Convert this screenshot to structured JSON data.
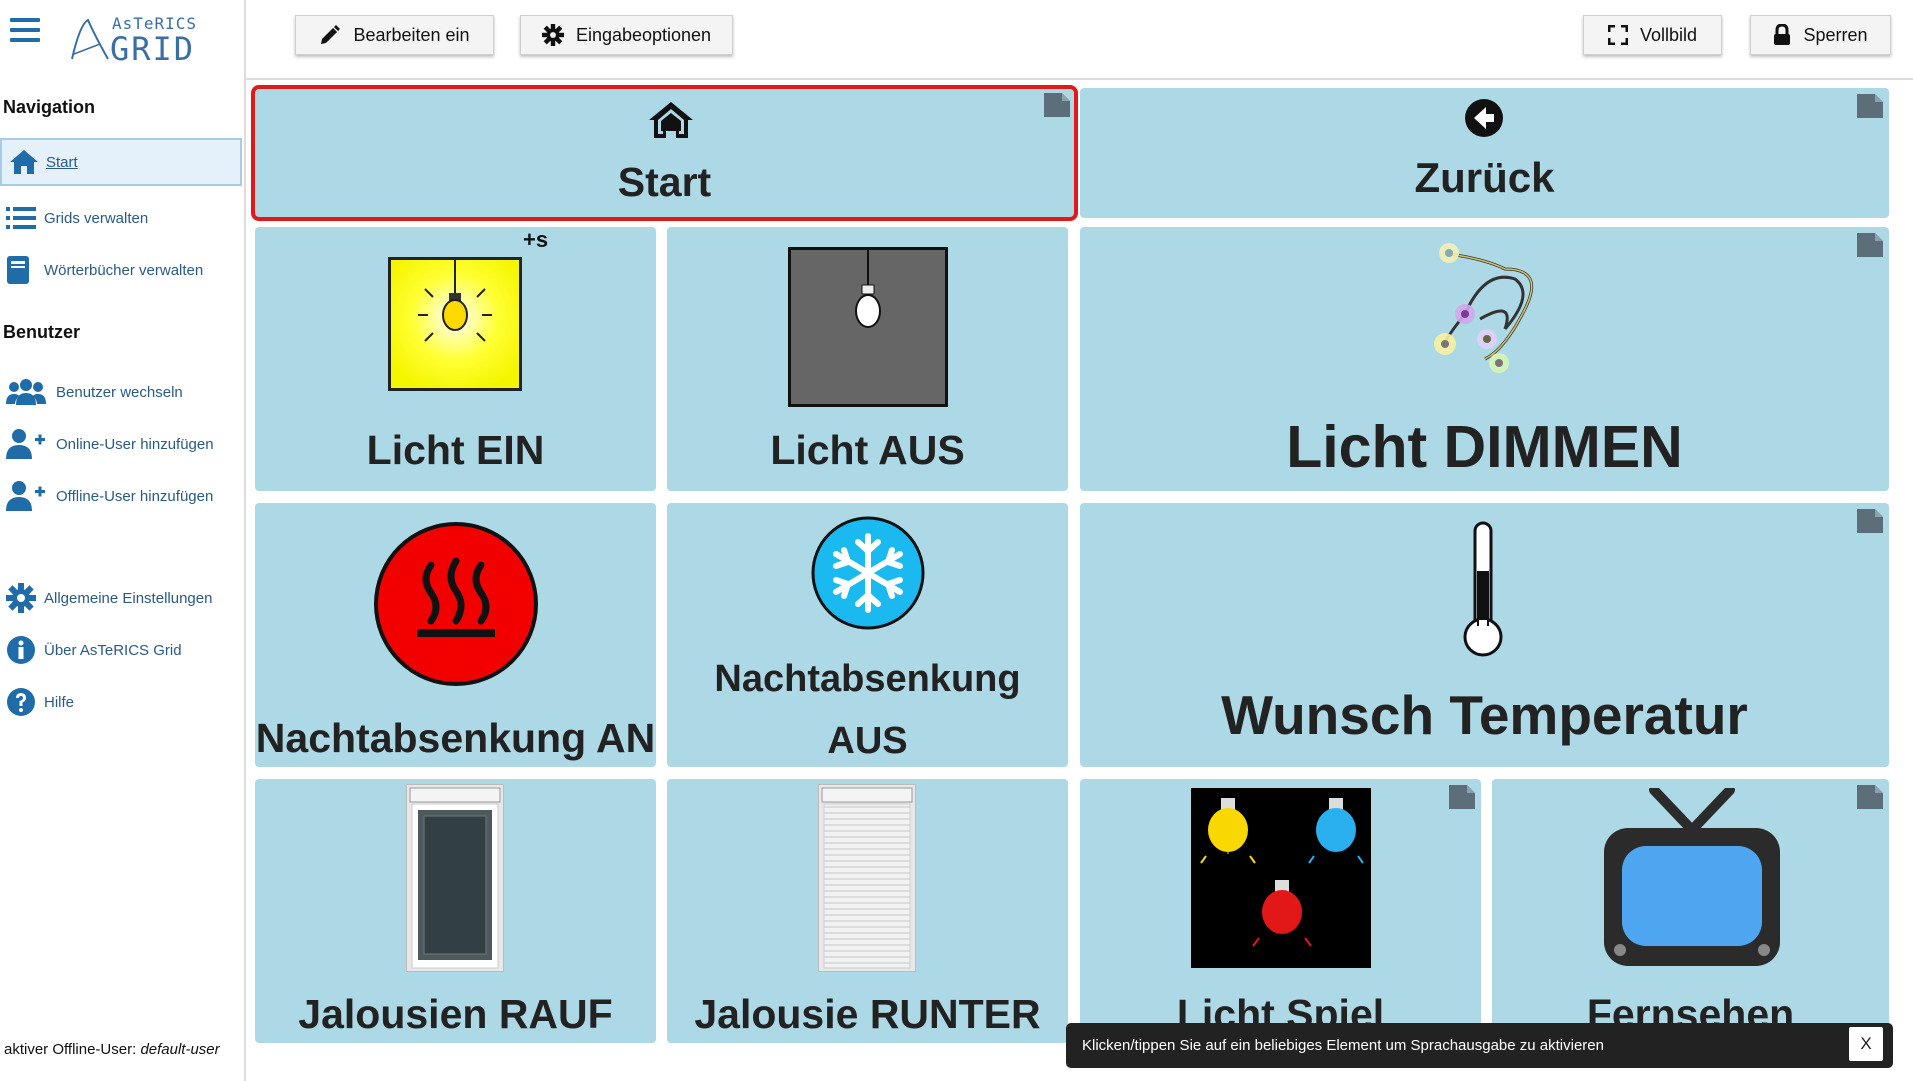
{
  "app": {
    "logo_line1": "AsTeRICS",
    "logo_line2": "GRID"
  },
  "sidebar": {
    "navigation_heading": "Navigation",
    "user_heading": "Benutzer",
    "items": [
      {
        "label": "Start",
        "icon": "home-icon",
        "active": true
      },
      {
        "label": "Grids verwalten",
        "icon": "list-icon"
      },
      {
        "label": "Wörterbücher verwalten",
        "icon": "book-icon"
      },
      {
        "label": "Benutzer wechseln",
        "icon": "users-icon"
      },
      {
        "label": "Online-User hinzufügen",
        "icon": "user-plus-icon"
      },
      {
        "label": "Offline-User hinzufügen",
        "icon": "user-plus-icon"
      },
      {
        "label": "Allgemeine Einstellungen",
        "icon": "gear-icon"
      },
      {
        "label": "Über AsTeRICS Grid",
        "icon": "info-icon"
      },
      {
        "label": "Hilfe",
        "icon": "help-icon"
      }
    ],
    "footer_prefix": "aktiver Offline-User:",
    "footer_user": "default-user"
  },
  "toolbar": {
    "edit_label": "Bearbeiten ein",
    "input_options_label": "Eingabeoptionen",
    "fullscreen_label": "Vollbild",
    "lock_label": "Sperren"
  },
  "grid": {
    "cells": [
      {
        "label": "Start",
        "icon": "home-icon",
        "selected": true
      },
      {
        "label": "Zurück",
        "icon": "arrow-left-circle-icon"
      },
      {
        "label": "Licht EIN",
        "icon": "light-on-icon",
        "badge": "+s"
      },
      {
        "label": "Licht AUS",
        "icon": "light-off-icon"
      },
      {
        "label": "Licht DIMMEN",
        "icon": "light-chain-icon"
      },
      {
        "label": "Nachtabsenkung AN",
        "icon": "heating-icon"
      },
      {
        "label_line1": "Nachtabsenkung",
        "label_line2": "AUS",
        "icon": "snowflake-icon"
      },
      {
        "label": "Wunsch Temperatur",
        "icon": "thermometer-icon"
      },
      {
        "label": "Jalousien RAUF",
        "icon": "window-blind-up-icon"
      },
      {
        "label": "Jalousie RUNTER",
        "icon": "window-blind-down-icon"
      },
      {
        "label": "Licht Spiel",
        "icon": "colored-bulbs-icon"
      },
      {
        "label": "Fernsehen",
        "icon": "tv-icon"
      }
    ]
  },
  "toast": {
    "message": "Klicken/tippen Sie auf ein beliebiges Element um Sprachausgabe zu aktivieren",
    "close_label": "X"
  },
  "colors": {
    "cell_bg": "#add8e6",
    "selected_border": "#e0191b",
    "link_blue": "#2a5a85",
    "icon_blue": "#1f6ca8"
  }
}
